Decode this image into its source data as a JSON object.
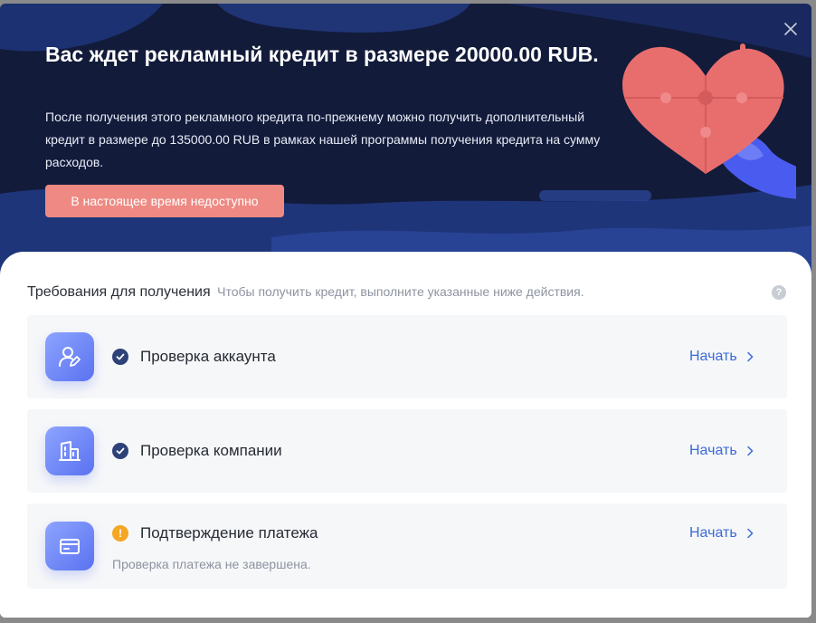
{
  "hero": {
    "title": "Вас ждет рекламный кредит в размере 20000.00 RUB.",
    "description": "После получения этого рекламного кредита по-прежнему можно получить дополнительный кредит в размере до 135000.00 RUB в рамках нашей программы получения кредита на сумму расходов.",
    "button_label": "В настоящее время недоступно"
  },
  "requirements": {
    "title": "Требования для получения",
    "subtitle": "Чтобы получить кредит, выполните указанные ниже действия.",
    "help_glyph": "?",
    "items": [
      {
        "icon": "user-edit-icon",
        "status": "completed",
        "status_icon": "check-circle-icon",
        "title": "Проверка аккаунта",
        "action_label": "Начать"
      },
      {
        "icon": "building-icon",
        "status": "completed",
        "status_icon": "check-circle-icon",
        "title": "Проверка компании",
        "action_label": "Начать"
      },
      {
        "icon": "card-icon",
        "status": "warning",
        "status_icon": "warning-circle-icon",
        "status_glyph": "!",
        "title": "Подтверждение платежа",
        "note": "Проверка платежа не завершена.",
        "action_label": "Начать"
      }
    ]
  },
  "colors": {
    "hero_background": "#121b3a",
    "button": "#ee8a83",
    "link": "#3b6bd6",
    "status_ok": "#2d4278",
    "status_warning": "#f5a623"
  }
}
